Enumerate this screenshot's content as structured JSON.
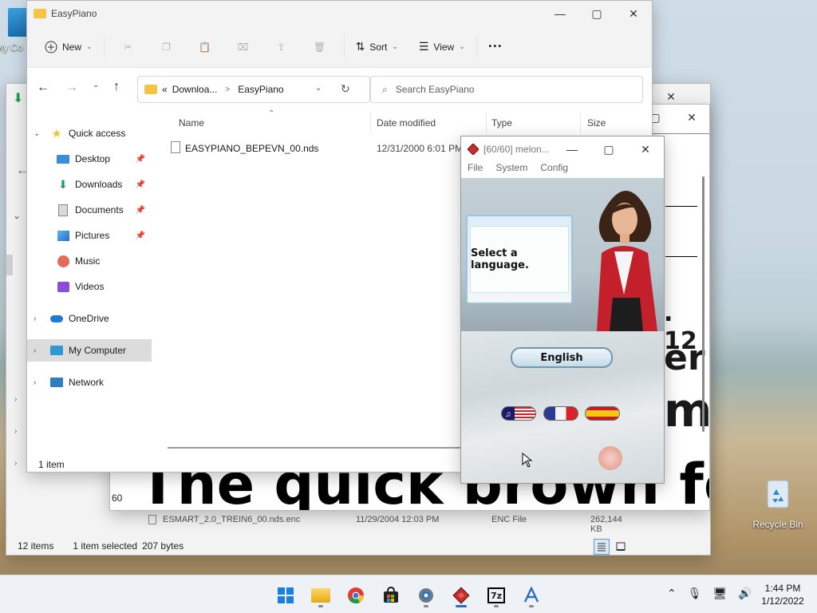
{
  "desktop": {
    "my_computer_label": "My Co",
    "recycle_bin_label": "Recycle Bin"
  },
  "back_window": {
    "status_items": "12 items",
    "status_selected": "1 item selected",
    "status_size": "207 bytes",
    "row": {
      "name": "ESMART_2.0_TREIN6_00.nds.enc",
      "date": "11/29/2004 12:03 PM",
      "type": "ENC File",
      "size": "262,144 KB"
    }
  },
  "font_preview": {
    "line1": ". 12",
    "line2": "er",
    "line3": "m",
    "line_main": "The quick brown fox",
    "size_label": "60"
  },
  "explorer": {
    "title": "EasyPiano",
    "toolbar": {
      "new_label": "New",
      "sort_label": "Sort",
      "view_label": "View"
    },
    "address": {
      "prefix": "«",
      "seg1": "Downloa...",
      "sep": ">",
      "seg2": "EasyPiano"
    },
    "search_placeholder": "Search EasyPiano",
    "sidebar": [
      {
        "label": "Quick access"
      },
      {
        "label": "Desktop"
      },
      {
        "label": "Downloads"
      },
      {
        "label": "Documents"
      },
      {
        "label": "Pictures"
      },
      {
        "label": "Music"
      },
      {
        "label": "Videos"
      },
      {
        "label": "OneDrive"
      },
      {
        "label": "My Computer"
      },
      {
        "label": "Network"
      }
    ],
    "columns": {
      "name": "Name",
      "date": "Date modified",
      "type": "Type",
      "size": "Size"
    },
    "files": [
      {
        "name": "EASYPIANO_BEPEVN_00.nds",
        "date": "12/31/2000 6:01 PM"
      }
    ],
    "status": "1 item"
  },
  "melon": {
    "title": "[60/60] melon...",
    "menu": [
      "File",
      "System",
      "Config"
    ],
    "prompt": "Select a language.",
    "english_button": "English",
    "flags": [
      "us-flag",
      "fr-flag",
      "es-flag"
    ]
  },
  "taskbar": {
    "apps": [
      "start",
      "file-explorer",
      "chrome",
      "store",
      "settings",
      "melonds",
      "7zip",
      "font-viewer"
    ],
    "time": "1:44 PM",
    "date": "1/12/2022"
  }
}
